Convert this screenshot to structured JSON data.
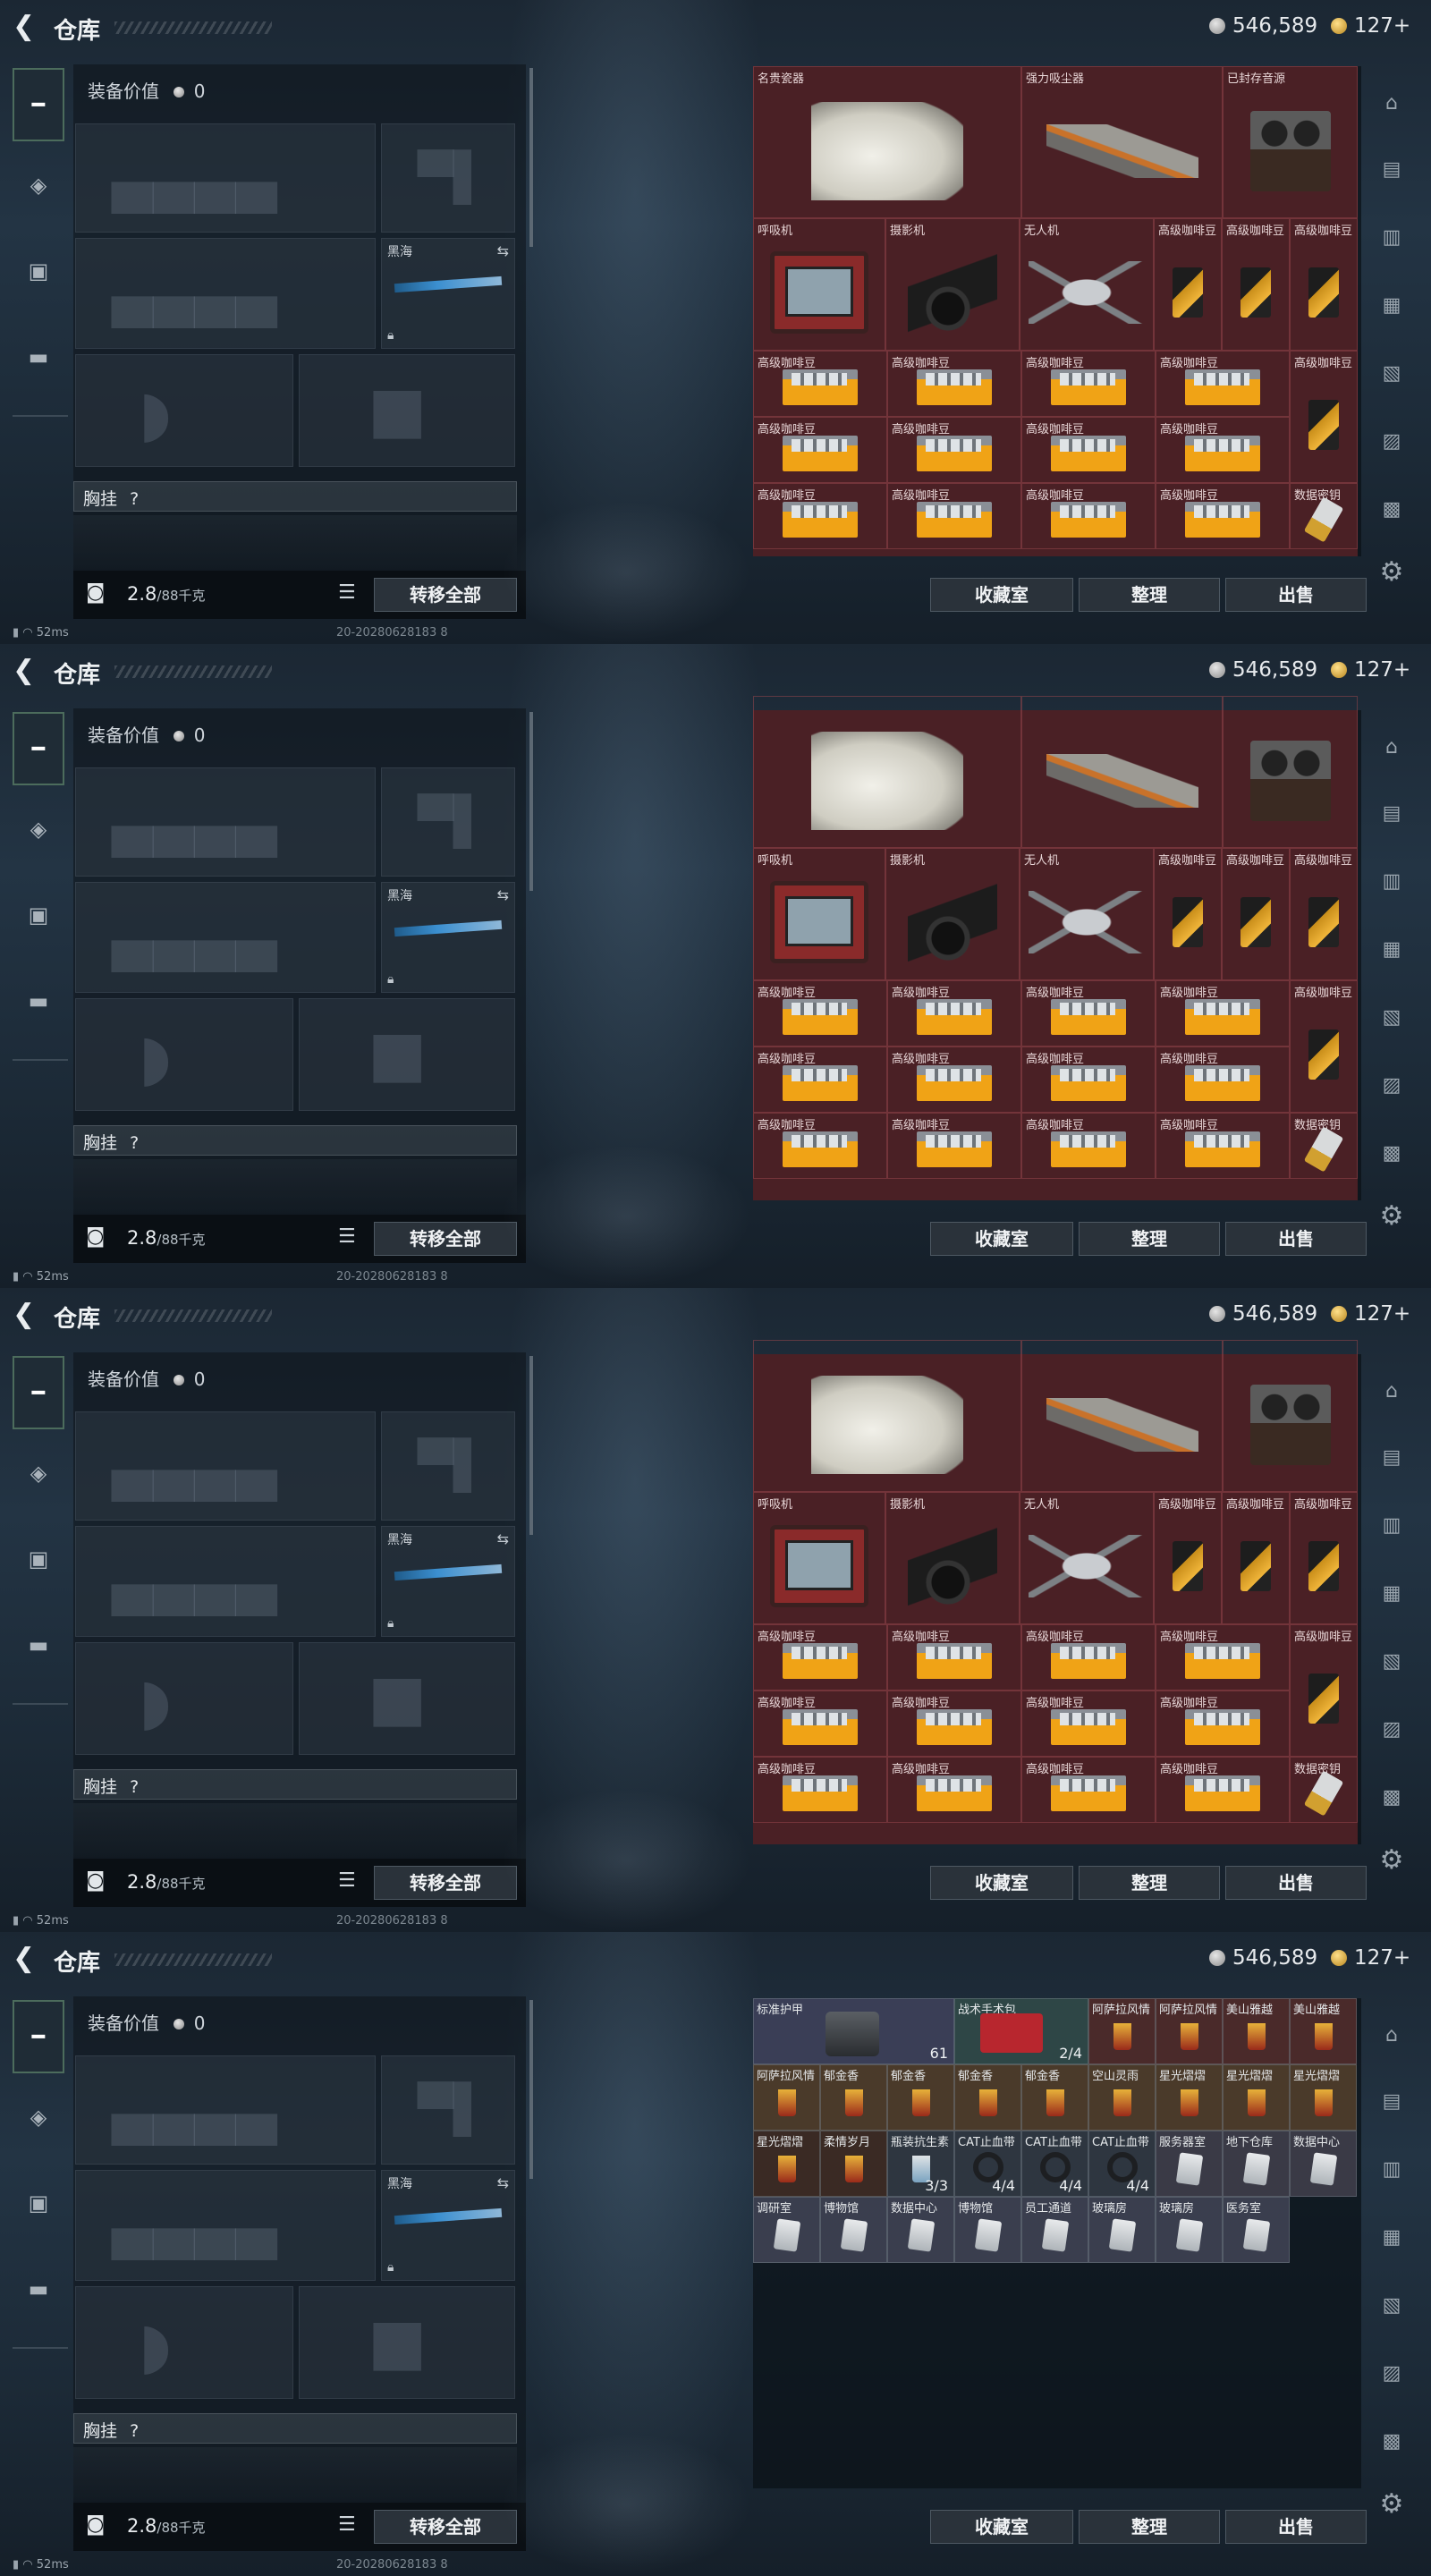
{
  "app": {
    "title": "仓库",
    "back_icon": "back-arrow-icon",
    "silver_amount": "546,589",
    "gold_amount": "127+",
    "accent_color": "#4a2025"
  },
  "equipment": {
    "value_label": "装备价值",
    "value": "0",
    "secondary_weapon_name": "黑海",
    "chest_rig_label": "胸挂",
    "chest_rig_help": "?",
    "weight_current": "2.8",
    "weight_max": "/88千克",
    "transfer_all_label": "转移全部"
  },
  "inventory_buttons": {
    "collection_label": "收藏室",
    "sort_label": "整理",
    "sell_label": "出售"
  },
  "status": {
    "ping": "52ms",
    "stamp": "20-20280628183 8"
  },
  "panel1_labels": {
    "vase": "名贵瓷器",
    "vacuum": "强力吸尘器",
    "tape": "已封存音源",
    "radio": "呼吸机",
    "camera": "摄影机",
    "drone": "无人机",
    "coffee": "高级咖啡豆",
    "usb": "数据密钥"
  },
  "panel4_items": [
    {
      "label": "标准护甲",
      "count": "61"
    },
    {
      "label": "战术手术包",
      "count": "2/4"
    },
    {
      "label": "阿萨拉风情",
      "count": ""
    },
    {
      "label": "阿萨拉风情",
      "count": ""
    },
    {
      "label": "美山雅越",
      "count": ""
    },
    {
      "label": "美山雅越",
      "count": ""
    },
    {
      "label": "阿萨拉风情",
      "count": ""
    },
    {
      "label": "郁金香",
      "count": ""
    },
    {
      "label": "郁金香",
      "count": ""
    },
    {
      "label": "郁金香",
      "count": ""
    },
    {
      "label": "郁金香",
      "count": ""
    },
    {
      "label": "空山灵雨",
      "count": ""
    },
    {
      "label": "星光熠熠",
      "count": ""
    },
    {
      "label": "星光熠熠",
      "count": ""
    },
    {
      "label": "星光熠熠",
      "count": ""
    },
    {
      "label": "星光熠熠",
      "count": ""
    },
    {
      "label": "柔情岁月",
      "count": ""
    },
    {
      "label": "瓶装抗生素",
      "count": "3/3"
    },
    {
      "label": "CAT止血带",
      "count": "4/4"
    },
    {
      "label": "CAT止血带",
      "count": "4/4"
    },
    {
      "label": "CAT止血带",
      "count": "4/4"
    },
    {
      "label": "服务器室",
      "count": ""
    },
    {
      "label": "地下仓库",
      "count": ""
    },
    {
      "label": "数据中心",
      "count": ""
    },
    {
      "label": "调研室",
      "count": ""
    },
    {
      "label": "博物馆",
      "count": ""
    },
    {
      "label": "数据中心",
      "count": ""
    },
    {
      "label": "博物馆",
      "count": ""
    },
    {
      "label": "员工通道",
      "count": ""
    },
    {
      "label": "玻璃房",
      "count": ""
    },
    {
      "label": "玻璃房",
      "count": ""
    },
    {
      "label": "医务室",
      "count": ""
    }
  ]
}
